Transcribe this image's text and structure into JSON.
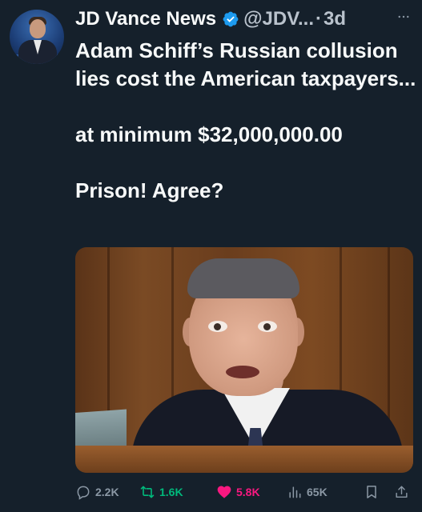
{
  "tweet": {
    "author_name": "JD Vance News",
    "handle": "@JDV...",
    "separator": "·",
    "time": "3d",
    "text_line_1": "Adam Schiff’s Russian collusion lies cost the American taxpayers...",
    "text_line_2": "at minimum $32,000,000.00",
    "text_line_3": "Prison!  Agree?",
    "more_icon": "more-horizontal-icon"
  },
  "actions": {
    "replies": "2.2K",
    "reposts": "1.6K",
    "likes": "5.8K",
    "views": "65K"
  },
  "colors": {
    "background": "#15202b",
    "verified": "#1d9bf0",
    "repost_active": "#00ba7c",
    "like_active": "#f91880"
  }
}
